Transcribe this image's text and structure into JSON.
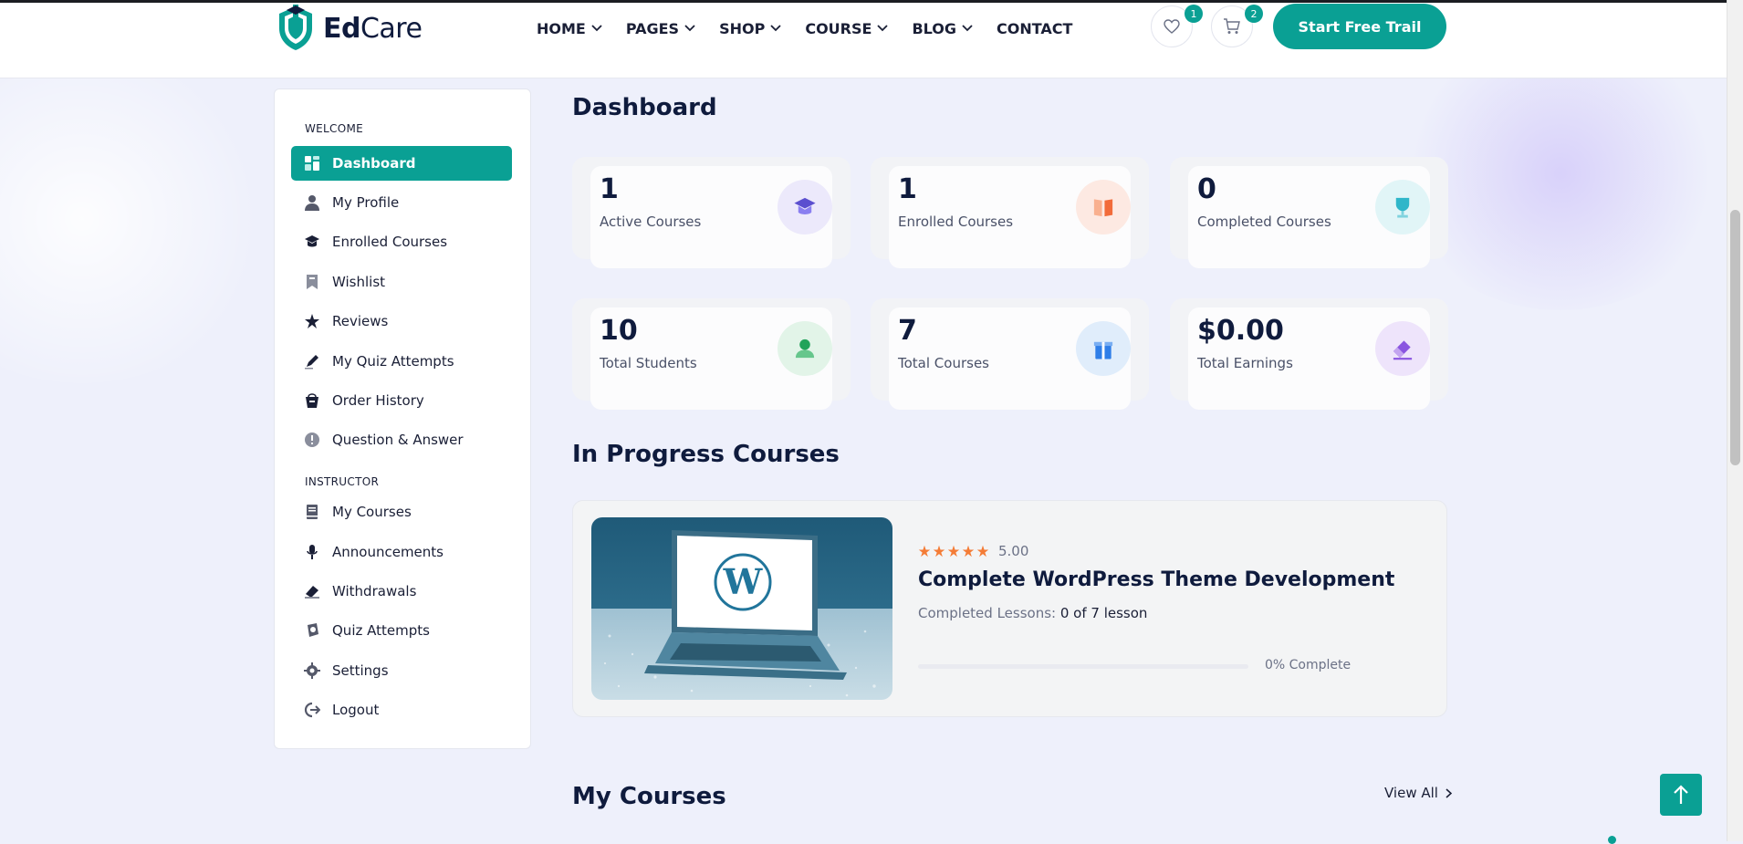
{
  "brand": {
    "name_bold": "Ed",
    "name_rest": "Care"
  },
  "nav": [
    {
      "label": "HOME"
    },
    {
      "label": "PAGES"
    },
    {
      "label": "SHOP"
    },
    {
      "label": "COURSE"
    },
    {
      "label": "BLOG"
    },
    {
      "label": "CONTACT"
    }
  ],
  "header": {
    "wishlist_count": "1",
    "cart_count": "2",
    "cta_label": "Start Free Trail"
  },
  "sidebar": {
    "welcome_title": "WELCOME",
    "welcome_items": [
      {
        "label": "Dashboard",
        "icon": "dashboard-icon",
        "active": true
      },
      {
        "label": "My Profile",
        "icon": "user-icon"
      },
      {
        "label": "Enrolled Courses",
        "icon": "graduation-cap-icon"
      },
      {
        "label": "Wishlist",
        "icon": "bookmark-icon"
      },
      {
        "label": "Reviews",
        "icon": "star-icon"
      },
      {
        "label": "My Quiz Attempts",
        "icon": "pencil-icon"
      },
      {
        "label": "Order History",
        "icon": "basket-icon"
      },
      {
        "label": "Question & Answer",
        "icon": "info-icon"
      }
    ],
    "instructor_title": "INSTRUCTOR",
    "instructor_items": [
      {
        "label": "My Courses",
        "icon": "book-icon"
      },
      {
        "label": "Announcements",
        "icon": "microphone-icon"
      },
      {
        "label": "Withdrawals",
        "icon": "money-icon"
      },
      {
        "label": "Quiz Attempts",
        "icon": "quiz-icon"
      },
      {
        "label": "Settings",
        "icon": "gear-icon"
      },
      {
        "label": "Logout",
        "icon": "logout-icon"
      }
    ]
  },
  "dashboard": {
    "title": "Dashboard",
    "stats": [
      {
        "value": "1",
        "label": "Active Courses",
        "icon": "graduation-cap-icon",
        "color": "#5b4fcf",
        "bg": "#ece9fb"
      },
      {
        "value": "1",
        "label": "Enrolled Courses",
        "icon": "open-book-icon",
        "color": "#f26b3a",
        "bg": "#fde9e2"
      },
      {
        "value": "0",
        "label": "Completed Courses",
        "icon": "trophy-icon",
        "color": "#2fb6c9",
        "bg": "#e1f5f7"
      },
      {
        "value": "10",
        "label": "Total Students",
        "icon": "student-icon",
        "color": "#22a35a",
        "bg": "#e2f4e8"
      },
      {
        "value": "7",
        "label": "Total Courses",
        "icon": "gift-box-icon",
        "color": "#2f7ee8",
        "bg": "#e0edfb"
      },
      {
        "value": "$0.00",
        "label": "Total Earnings",
        "icon": "eraser-icon",
        "color": "#8a55e0",
        "bg": "#eee4fb"
      }
    ]
  },
  "in_progress": {
    "title": "In Progress Courses",
    "course": {
      "rating": "5.00",
      "title": "Complete WordPress Theme Development",
      "lessons_label": "Completed Lessons:",
      "lessons_value": "0 of 7 lesson",
      "progress_percent": 0,
      "progress_text": "0% Complete"
    }
  },
  "my_courses": {
    "title": "My Courses",
    "view_all": "View All"
  },
  "colors": {
    "accent": "#0aa094",
    "star": "#f47c36"
  }
}
